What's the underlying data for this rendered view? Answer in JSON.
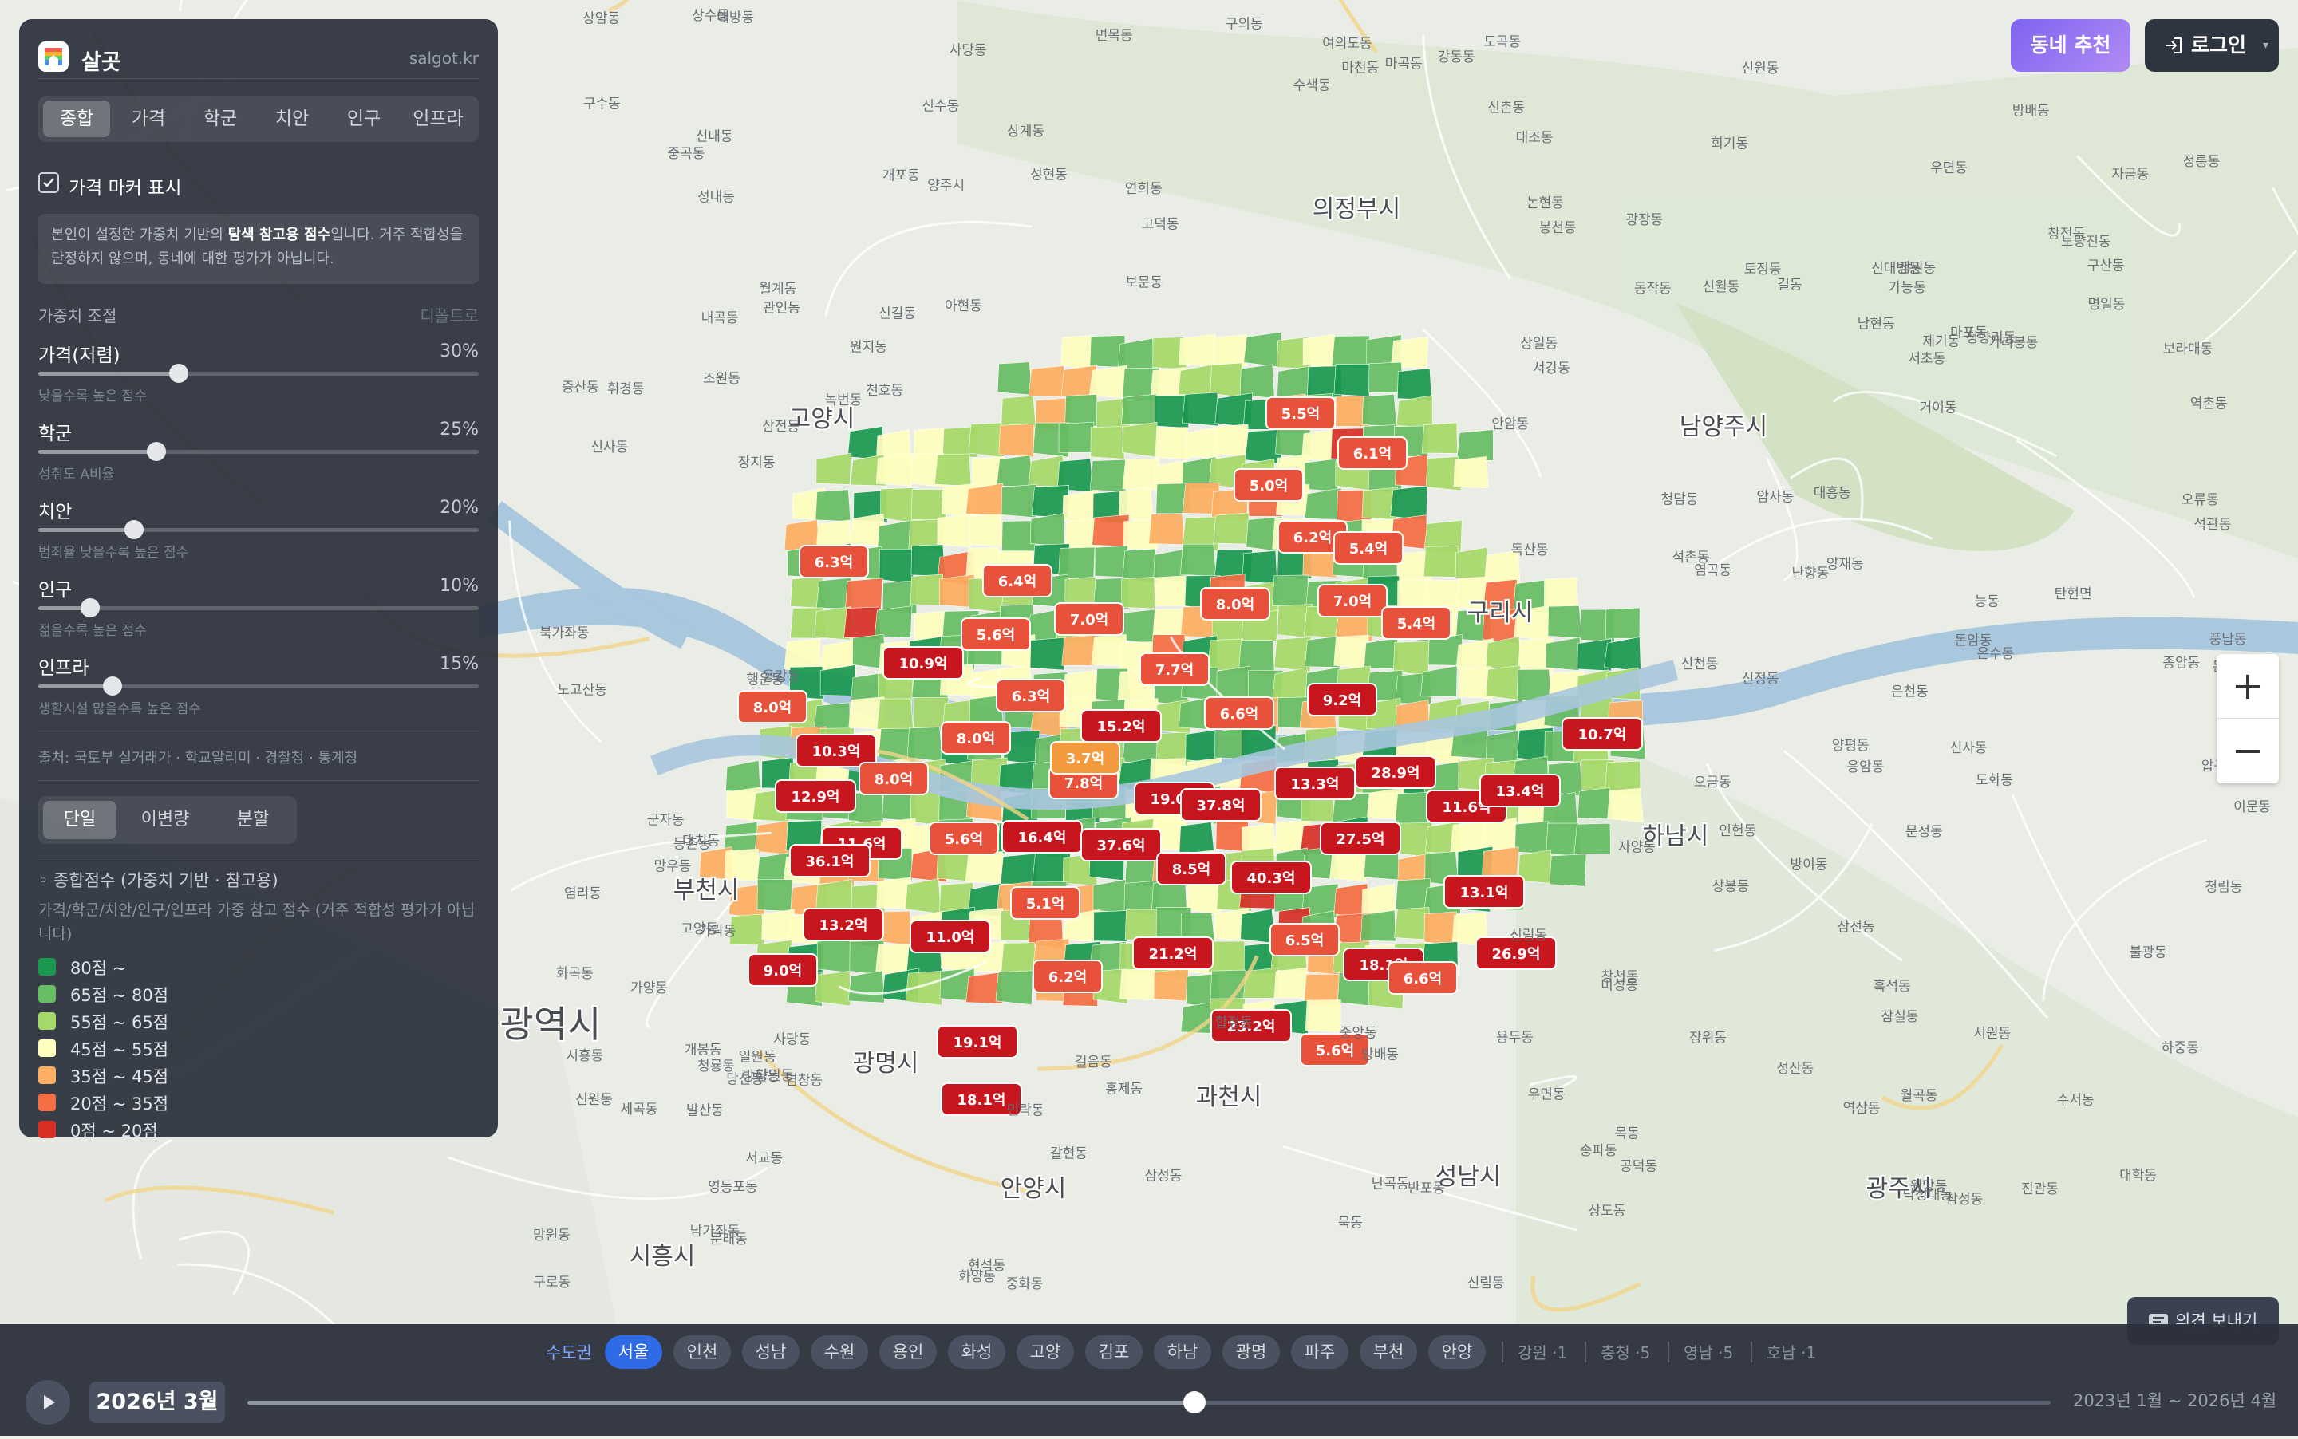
{
  "app": {
    "name": "살곳",
    "site": "salgot.kr"
  },
  "tabs": [
    "종합",
    "가격",
    "학군",
    "치안",
    "인구",
    "인프라"
  ],
  "active_tab": "종합",
  "price_marker_toggle": {
    "label": "가격 마커 표시",
    "checked": true
  },
  "notice": {
    "pre": "본인이 설정한 가중치 기반의 ",
    "bold": "탐색 참고용 점수",
    "post": "입니다. 거주 적합성을 단정하지 않으며, 동네에 대한 평가가 아닙니다."
  },
  "weights": {
    "title": "가중치 조절",
    "reset_label": "디폴트로",
    "items": [
      {
        "name": "가격(저렴)",
        "value": "30%",
        "hint": "낮을수록 높은 점수",
        "level": 0.3
      },
      {
        "name": "학군",
        "value": "25%",
        "hint": "성취도 A비율",
        "level": 0.25
      },
      {
        "name": "치안",
        "value": "20%",
        "hint": "범죄율 낮을수록 높은 점수",
        "level": 0.2
      },
      {
        "name": "인구",
        "value": "10%",
        "hint": "젊을수록 높은 점수",
        "level": 0.1
      },
      {
        "name": "인프라",
        "value": "15%",
        "hint": "생활시설 많을수록 높은 점수",
        "level": 0.15
      }
    ]
  },
  "source": "출처: 국토부 실거래가 · 학교알리미 · 경찰청 · 통계청",
  "view_modes": [
    "단일",
    "이변량",
    "분할"
  ],
  "active_view_mode": "단일",
  "legend": {
    "title": "◦ 종합점수 (가중치 기반 · 참고용)",
    "description": "가격/학군/치안/인구/인프라 가중 참고 점수 (거주 적합성 평가가 아닙니다)",
    "items": [
      {
        "label": "80점 ~",
        "color": "#1a9850"
      },
      {
        "label": "65점 ~ 80점",
        "color": "#66bd63"
      },
      {
        "label": "55점 ~ 65점",
        "color": "#a6d96a"
      },
      {
        "label": "45점 ~ 55점",
        "color": "#ffffbf"
      },
      {
        "label": "35점 ~ 45점",
        "color": "#fdae61"
      },
      {
        "label": "20점 ~ 35점",
        "color": "#f46d43"
      },
      {
        "label": "0점 ~ 20점",
        "color": "#d73027"
      }
    ]
  },
  "header_buttons": {
    "recommend": "동네 추천",
    "login": "로그인"
  },
  "zoom": {
    "in": "+",
    "out": "−"
  },
  "feedback_label": "의견 보내기",
  "regions": {
    "group_label": "수도권",
    "chips": [
      "서울",
      "인천",
      "성남",
      "수원",
      "용인",
      "화성",
      "고양",
      "김포",
      "하남",
      "광명",
      "파주",
      "부천",
      "안양"
    ],
    "active": "서울",
    "others": [
      {
        "name": "강원",
        "count": "·1"
      },
      {
        "name": "충청",
        "count": "·5"
      },
      {
        "name": "영남",
        "count": "·5"
      },
      {
        "name": "호남",
        "count": "·1"
      }
    ]
  },
  "timeline": {
    "current": "2026년 3월",
    "range": "2023년 1월 ~ 2026년 4월",
    "progress": 0.95
  },
  "price_markers": [
    "5.5억",
    "6.1억",
    "5.0억",
    "6.2억",
    "5.4억",
    "6.3억",
    "6.4억",
    "7.0억",
    "8.0억",
    "7.0억",
    "5.4억",
    "5.6억",
    "10.9억",
    "7.7억",
    "6.6억",
    "9.2억",
    "6.3억",
    "8.0억",
    "15.2억",
    "10.7억",
    "8.0억",
    "10.3억",
    "8.0억",
    "7.8억",
    "13.3억",
    "28.9억",
    "12.9억",
    "11.6억",
    "19.0억",
    "37.8억",
    "13.4억",
    "11.6억",
    "16.4억",
    "37.6억",
    "27.5억",
    "36.1억",
    "5.6억",
    "8.5억",
    "40.3억",
    "13.1억",
    "13.2억",
    "5.1억",
    "11.0억",
    "6.5억",
    "21.2억",
    "18.1억",
    "26.9억",
    "9.0억",
    "6.2억",
    "6.6억",
    "23.2억",
    "19.1억",
    "5.6억",
    "18.1억",
    "3.7억"
  ],
  "map_labels": {
    "cities": [
      "의정부시",
      "고양시",
      "남양주시",
      "구리시",
      "하남시",
      "부천시",
      "광명시",
      "안양시",
      "성남시",
      "광주시",
      "시흥시",
      "과천시",
      "광역시"
    ],
    "districts": [
      "양주시",
      "탄현면",
      "원당동",
      "고양동",
      "관인동",
      "민락동",
      "자금동",
      "가능동",
      "상계동",
      "월계동",
      "정릉동",
      "홍제동",
      "신촌동",
      "서교동",
      "마포동",
      "강동동",
      "송파동",
      "대치동",
      "양재동",
      "수서동",
      "세곡동",
      "우면동",
      "방배동",
      "사당동",
      "신림동",
      "봉천동",
      "구로동",
      "개봉동",
      "오류동",
      "온수동",
      "가리봉동",
      "독산동",
      "시흥동",
      "목동",
      "신월동",
      "화곡동",
      "방화동",
      "가양동",
      "마곡동",
      "발산동",
      "등촌동",
      "염창동",
      "당산동",
      "영등포동",
      "여의도동",
      "노량진동",
      "흑석동",
      "상도동",
      "대방동",
      "신대방동",
      "신길동",
      "문래동",
      "양평동",
      "합정동",
      "망원동",
      "성산동",
      "상암동",
      "수색동",
      "증산동",
      "응암동",
      "역촌동",
      "불광동",
      "갈현동",
      "구산동",
      "진관동",
      "녹번동",
      "대조동",
      "연희동",
      "남가좌동",
      "북가좌동",
      "창천동",
      "아현동",
      "공덕동",
      "도화동",
      "용강동",
      "대흥동",
      "염리동",
      "노고산동",
      "신수동",
      "현석동",
      "상수동",
      "구수동",
      "토정동",
      "하중동",
      "창전동",
      "신정동",
      "당인동",
      "서강동",
      "석관동",
      "장위동",
      "월곡동",
      "종암동",
      "길음동",
      "돈암동",
      "삼선동",
      "보문동",
      "안암동",
      "용두동",
      "제기동",
      "청량리동",
      "회기동",
      "휘경동",
      "이문동",
      "묵동",
      "중화동",
      "상봉동",
      "망우동",
      "신내동",
      "면목동",
      "중곡동",
      "능동",
      "구의동",
      "자양동",
      "화양동",
      "군자동",
      "광장동",
      "천호동",
      "암사동",
      "고덕동",
      "상일동",
      "명일동",
      "길동",
      "둔촌동",
      "성내동",
      "풍납동",
      "잠실동",
      "석촌동",
      "가락동",
      "문정동",
      "장지동",
      "거여동",
      "마천동",
      "오금동",
      "방이동",
      "삼전동",
      "신천동",
      "개포동",
      "일원동",
      "도곡동",
      "역삼동",
      "삼성동",
      "청담동",
      "압구정동",
      "신사동",
      "논현동",
      "반포동",
      "서초동",
      "잠원동",
      "내곡동",
      "염곡동",
      "원지동",
      "신원동",
      "우면동",
      "방배동",
      "사당동",
      "동작동",
      "남현동",
      "인헌동",
      "낙성대동",
      "서원동",
      "신원동",
      "조원동",
      "대학동",
      "삼성동",
      "미성동",
      "난곡동",
      "난향동",
      "신사동",
      "청림동",
      "행운동",
      "은천동",
      "중앙동",
      "보라매동",
      "청룡동",
      "성현동",
      "신림동"
    ]
  }
}
